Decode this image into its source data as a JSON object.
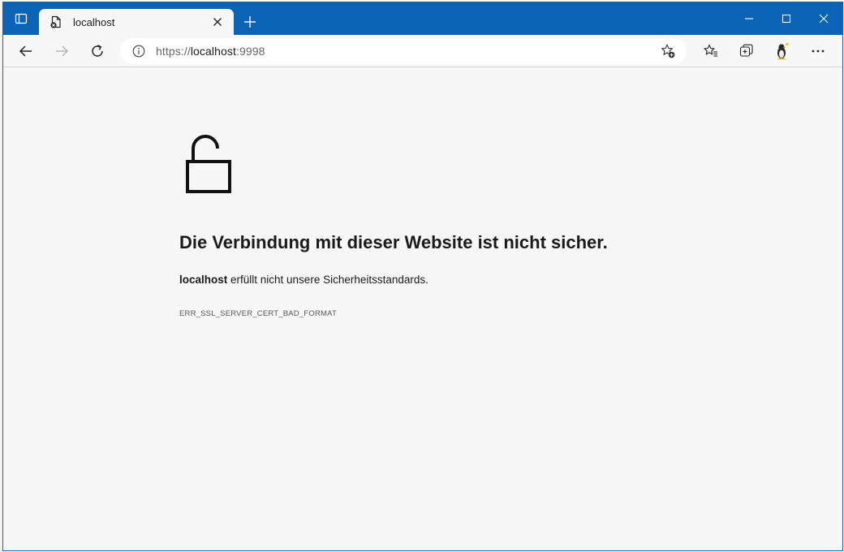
{
  "tab": {
    "title": "localhost",
    "new_tab_symbol": "+"
  },
  "address": {
    "scheme": "https://",
    "host": "localhost",
    "port": ":9998"
  },
  "error": {
    "heading": "Die Verbindung mit dieser Website ist nicht sicher.",
    "site": "localhost",
    "message": " erfüllt nicht unsere Sicherheitsstandards.",
    "code": "ERR_SSL_SERVER_CERT_BAD_FORMAT"
  },
  "icons": {
    "tab_actions": "tab-actions-icon",
    "favicon": "page-error-icon",
    "tab_close": "close-icon",
    "minimize": "minimize-icon",
    "maximize": "maximize-icon",
    "window_close": "close-icon",
    "back": "arrow-left-icon",
    "forward": "arrow-right-icon",
    "refresh": "refresh-icon",
    "site_info": "info-icon",
    "add_favorite": "star-plus-icon",
    "favorites": "favorites-icon",
    "collections": "collections-icon",
    "profile": "avatar-icon",
    "more": "ellipsis-icon",
    "lock": "unlocked-padlock-icon"
  },
  "colors": {
    "titlebar": "#0a63b5",
    "page_bg": "#f7f7f7",
    "text": "#1a1a1a"
  }
}
